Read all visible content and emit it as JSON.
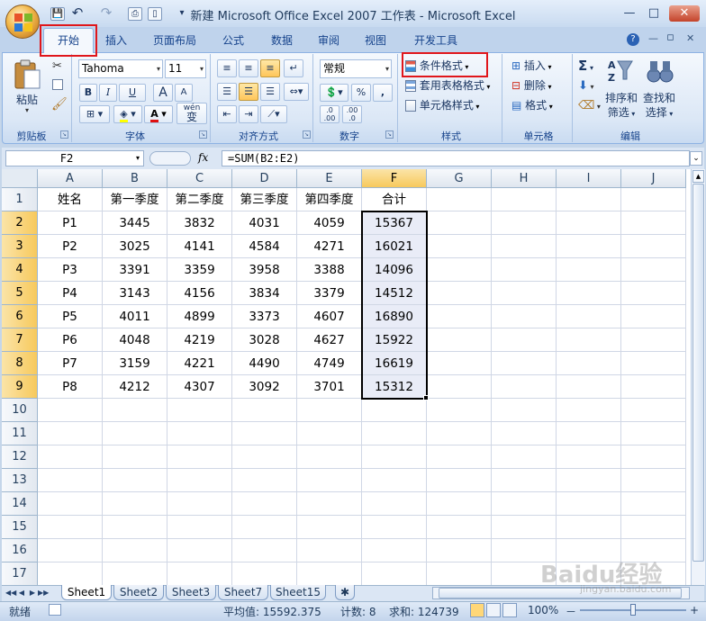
{
  "window": {
    "title": "新建 Microsoft Office Excel 2007 工作表 - Microsoft Excel",
    "minimize": "—",
    "maximize": "□",
    "close": "✕"
  },
  "qat": {
    "save": "💾",
    "undo": "↶",
    "redo": "↷",
    "more": "▾"
  },
  "ribbon_tabs": [
    "开始",
    "插入",
    "页面布局",
    "公式",
    "数据",
    "审阅",
    "视图",
    "开发工具"
  ],
  "ribbon_right": {
    "help": "?",
    "min": "—",
    "restore": "▫",
    "close": "✕"
  },
  "clipboard": {
    "paste": "粘贴",
    "label": "剪贴板"
  },
  "font": {
    "name": "Tahoma",
    "size": "11",
    "bold": "B",
    "italic": "I",
    "underline": "U",
    "grow": "A",
    "shrink": "A",
    "wen": "wén",
    "wen2": "变",
    "label": "字体"
  },
  "alignment": {
    "label": "对齐方式"
  },
  "number": {
    "format": "常规",
    "percent": "%",
    "comma": ",",
    "inc": ".0 .00",
    "dec": ".00 .0",
    "label": "数字"
  },
  "styles": {
    "conditional": "条件格式",
    "table": "套用表格格式",
    "cell": "单元格样式",
    "label": "样式"
  },
  "cells": {
    "insert": "插入",
    "delete": "删除",
    "format": "格式",
    "label": "单元格"
  },
  "editing": {
    "sigma": "Σ",
    "sort_l1": "排序和",
    "sort_l2": "筛选",
    "find_l1": "查找和",
    "find_l2": "选择",
    "label": "编辑"
  },
  "formula_bar": {
    "name_box": "F2",
    "fx": "fx",
    "formula": "=SUM(B2:E2)"
  },
  "columns": [
    "A",
    "B",
    "C",
    "D",
    "E",
    "F",
    "G",
    "H",
    "I",
    "J"
  ],
  "selected_column": "F",
  "row_numbers": [
    "1",
    "2",
    "3",
    "4",
    "5",
    "6",
    "7",
    "8",
    "9",
    "10",
    "11",
    "12",
    "13",
    "14",
    "15",
    "16",
    "17"
  ],
  "table": {
    "headers": [
      "姓名",
      "第一季度",
      "第二季度",
      "第三季度",
      "第四季度",
      "合计"
    ],
    "rows": [
      [
        "P1",
        "3445",
        "3832",
        "4031",
        "4059",
        "15367"
      ],
      [
        "P2",
        "3025",
        "4141",
        "4584",
        "4271",
        "16021"
      ],
      [
        "P3",
        "3391",
        "3359",
        "3958",
        "3388",
        "14096"
      ],
      [
        "P4",
        "3143",
        "4156",
        "3834",
        "3379",
        "14512"
      ],
      [
        "P5",
        "4011",
        "4899",
        "3373",
        "4607",
        "16890"
      ],
      [
        "P6",
        "4048",
        "4219",
        "3028",
        "4627",
        "15922"
      ],
      [
        "P7",
        "3159",
        "4221",
        "4490",
        "4749",
        "16619"
      ],
      [
        "P8",
        "4212",
        "4307",
        "3092",
        "3701",
        "15312"
      ]
    ]
  },
  "sheet_nav": [
    "◀◀",
    "◀",
    "▶",
    "▶▶"
  ],
  "sheets": [
    "Sheet1",
    "Sheet2",
    "Sheet3",
    "Sheet7",
    "Sheet15"
  ],
  "active_sheet": "Sheet1",
  "status": {
    "mode": "就绪",
    "average": "平均值: 15592.375",
    "count": "计数: 8",
    "sum": "求和: 124739",
    "zoom": "100%",
    "zoom_minus": "－",
    "zoom_plus": "+"
  },
  "watermark": {
    "brand": "Baidu经验",
    "url": "jingyan.baidu.com"
  }
}
